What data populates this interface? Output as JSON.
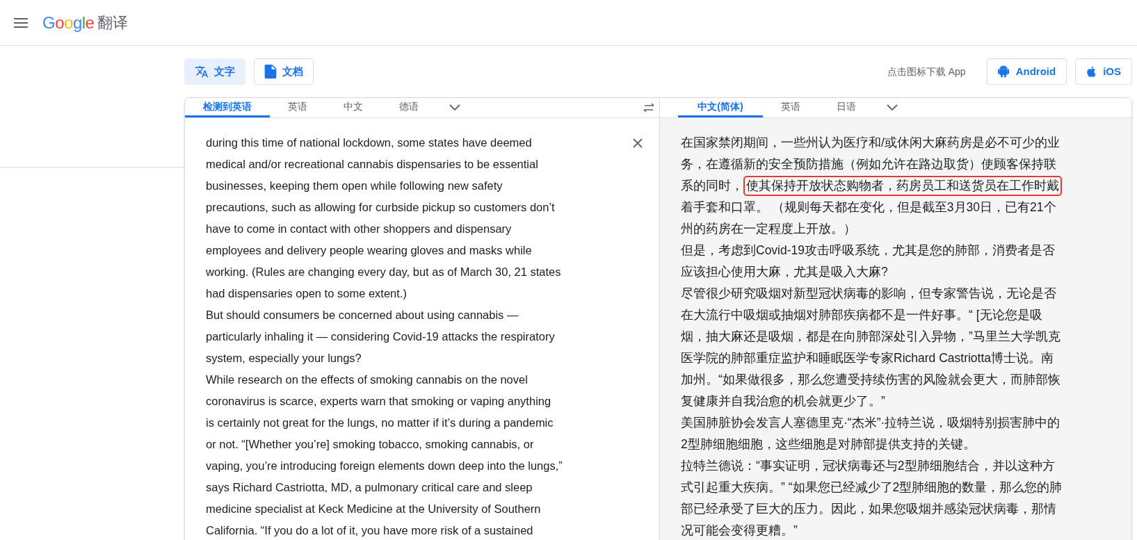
{
  "header": {
    "logo": "Google",
    "title": "翻译"
  },
  "mode_tabs": [
    {
      "label": "文字",
      "selected": true,
      "kind": "translate"
    },
    {
      "label": "文档",
      "selected": false,
      "kind": "document"
    }
  ],
  "app_download": {
    "prompt": "点击图标下载 App",
    "buttons": [
      {
        "label": "Android",
        "kind": "android"
      },
      {
        "label": "iOS",
        "kind": "apple"
      }
    ]
  },
  "source": {
    "languages": [
      {
        "label": "检测到英语",
        "selected": true
      },
      {
        "label": "英语",
        "selected": false
      },
      {
        "label": "中文",
        "selected": false
      },
      {
        "label": "德语",
        "selected": false
      }
    ],
    "paragraphs": [
      [
        "during this time of national lockdown, some states have deemed",
        "medical and/or recreational cannabis dispensaries to be essential",
        "businesses, keeping them open while following new safety",
        "precautions, such as allowing for curbside pickup so customers don’t",
        "have to come in contact with other shoppers and dispensary",
        "employees and delivery people wearing gloves and masks while",
        "working. (Rules are changing every day, but as of March 30, 21 states",
        "had dispensaries open to some extent.)"
      ],
      [
        "But should consumers be concerned about using cannabis —",
        "particularly inhaling it — considering Covid-19 attacks the respiratory",
        "system, especially your lungs?"
      ],
      [
        "While research on the effects of smoking cannabis on the novel",
        "coronavirus is scarce, experts warn that smoking or vaping anything",
        "is certainly not great for the lungs, no matter if it’s during a pandemic",
        "or not. “[Whether you’re] smoking tobacco, smoking cannabis, or",
        "vaping, you’re introducing foreign elements down deep into the lungs,”",
        "says Richard Castriotta, MD, a pulmonary critical care and sleep",
        "medicine specialist at Keck Medicine at the University of Southern",
        "California. “If you do a lot of it, you have more risk of a sustained"
      ]
    ]
  },
  "target": {
    "languages": [
      {
        "label": "中文(简体)",
        "selected": true
      },
      {
        "label": "英语",
        "selected": false
      },
      {
        "label": "日语",
        "selected": false
      }
    ],
    "paragraphs": [
      [
        [
          {
            "text": "在国家禁闭期间，一些州认为医疗和/或休闲大麻药房是必不可少的业",
            "highlighted": false
          }
        ],
        [
          {
            "text": "务，在遵循新的安全预防措施（例如允许在路边取货）使顾客保持联",
            "highlighted": false
          }
        ],
        [
          {
            "text": "系的同时，",
            "highlighted": false
          },
          {
            "text": "使其保持开放状态购物者，药房员工和送货员在工作时戴",
            "highlighted": true
          }
        ],
        [
          {
            "text": "着手套和口罩。 （规则每天都在变化，但是截至3月30日，已有21个",
            "highlighted": false
          }
        ],
        [
          {
            "text": "州的药房在一定程度上开放。）",
            "highlighted": false
          }
        ]
      ],
      [
        [
          {
            "text": "但是，考虑到Covid-19攻击呼吸系统，尤其是您的肺部，消费者是否",
            "highlighted": false
          }
        ],
        [
          {
            "text": "应该担心使用大麻，尤其是吸入大麻?",
            "highlighted": false
          }
        ]
      ],
      [
        [
          {
            "text": "尽管很少研究吸烟对新型冠状病毒的影响，但专家警告说，无论是否",
            "highlighted": false
          }
        ],
        [
          {
            "text": "在大流行中吸烟或抽烟对肺部疾病都不是一件好事。“ [无论您是吸",
            "highlighted": false
          }
        ],
        [
          {
            "text": "烟，抽大麻还是吸烟，都是在向肺部深处引入异物，”马里兰大学凯克",
            "highlighted": false
          }
        ],
        [
          {
            "text": "医学院的肺部重症监护和睡眠医学专家Richard Castriotta博士说。南",
            "highlighted": false
          }
        ],
        [
          {
            "text": "加州。“如果做很多，那么您遭受持续伤害的风险就会更大，而肺部恢",
            "highlighted": false
          }
        ],
        [
          {
            "text": "复健康并自我治愈的机会就更少了。”",
            "highlighted": false
          }
        ]
      ],
      [
        [
          {
            "text": "美国肺脏协会发言人塞德里克·“杰米”·拉特兰说，吸烟特别损害肺中的",
            "highlighted": false
          }
        ],
        [
          {
            "text": "2型肺细胞细胞，这些细胞是对肺部提供支持的关键。",
            "highlighted": false
          }
        ]
      ],
      [
        [
          {
            "text": "拉特兰德说：“事实证明，冠状病毒还与2型肺细胞结合，并以这种方",
            "highlighted": false
          }
        ],
        [
          {
            "text": "式引起重大疾病。” “如果您已经减少了2型肺细胞的数量，那么您的肺",
            "highlighted": false
          }
        ],
        [
          {
            "text": "部已经承受了巨大的压力。因此，如果您吸烟并感染冠状病毒，那情",
            "highlighted": false
          }
        ],
        [
          {
            "text": "况可能会变得更糟。”",
            "highlighted": false
          }
        ]
      ]
    ]
  }
}
